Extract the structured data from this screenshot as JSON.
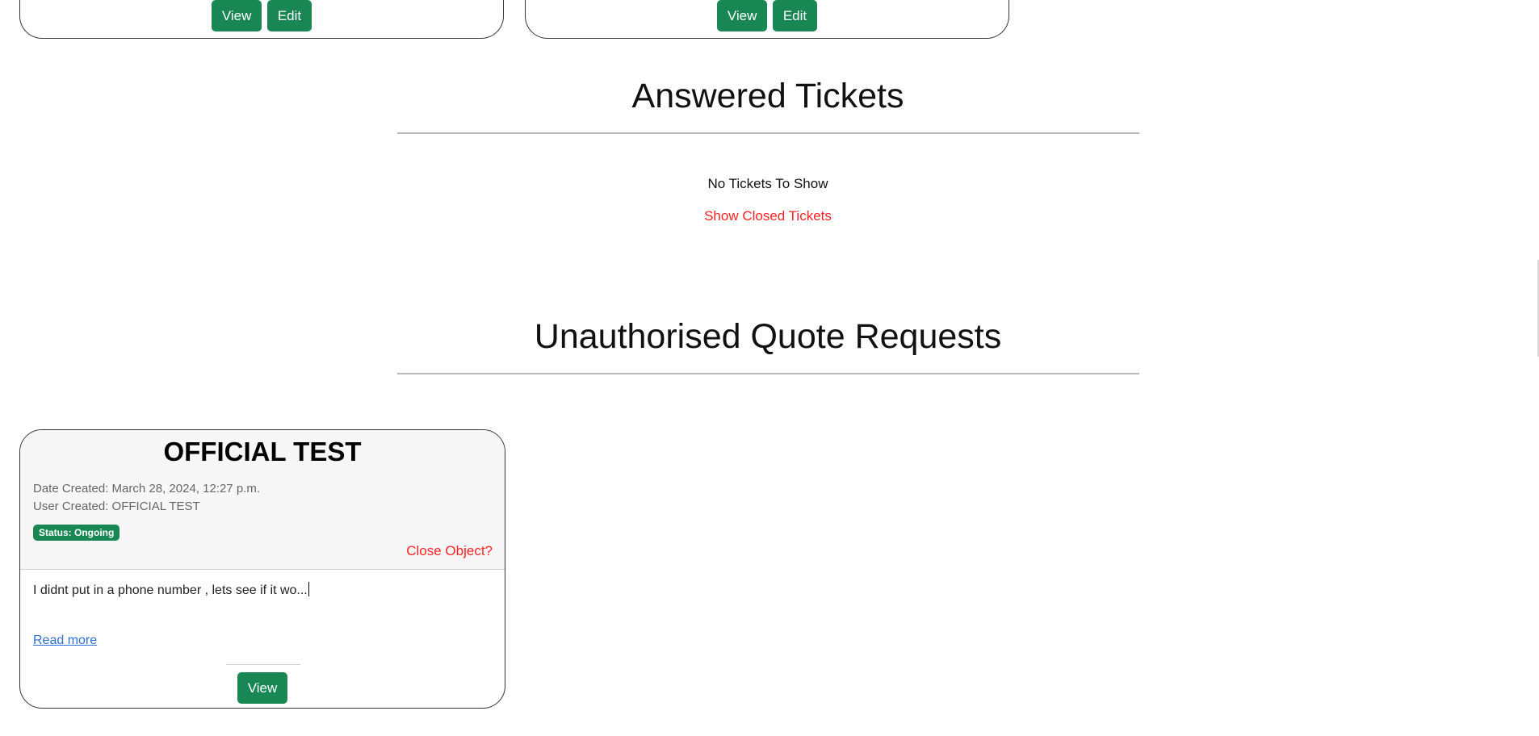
{
  "top_cards": [
    {
      "view_label": "View",
      "edit_label": "Edit"
    },
    {
      "view_label": "View",
      "edit_label": "Edit"
    }
  ],
  "answered": {
    "title": "Answered Tickets",
    "empty_message": "No Tickets To Show",
    "show_closed_label": "Show Closed Tickets"
  },
  "unauthorised": {
    "title": "Unauthorised Quote Requests",
    "cards": [
      {
        "title": "OFFICIAL TEST",
        "date_created": "Date Created: March 28, 2024, 12:27 p.m.",
        "user_created": "User Created: OFFICIAL TEST",
        "status": "Status: Ongoing",
        "close_label": "Close Object?",
        "excerpt": "I didnt put in a phone number , lets see if it wo...",
        "read_more_label": "Read more",
        "view_label": "View"
      }
    ]
  },
  "colors": {
    "primary_button": "#198754",
    "danger_link": "#ff2222",
    "link": "#2f6fd8"
  }
}
